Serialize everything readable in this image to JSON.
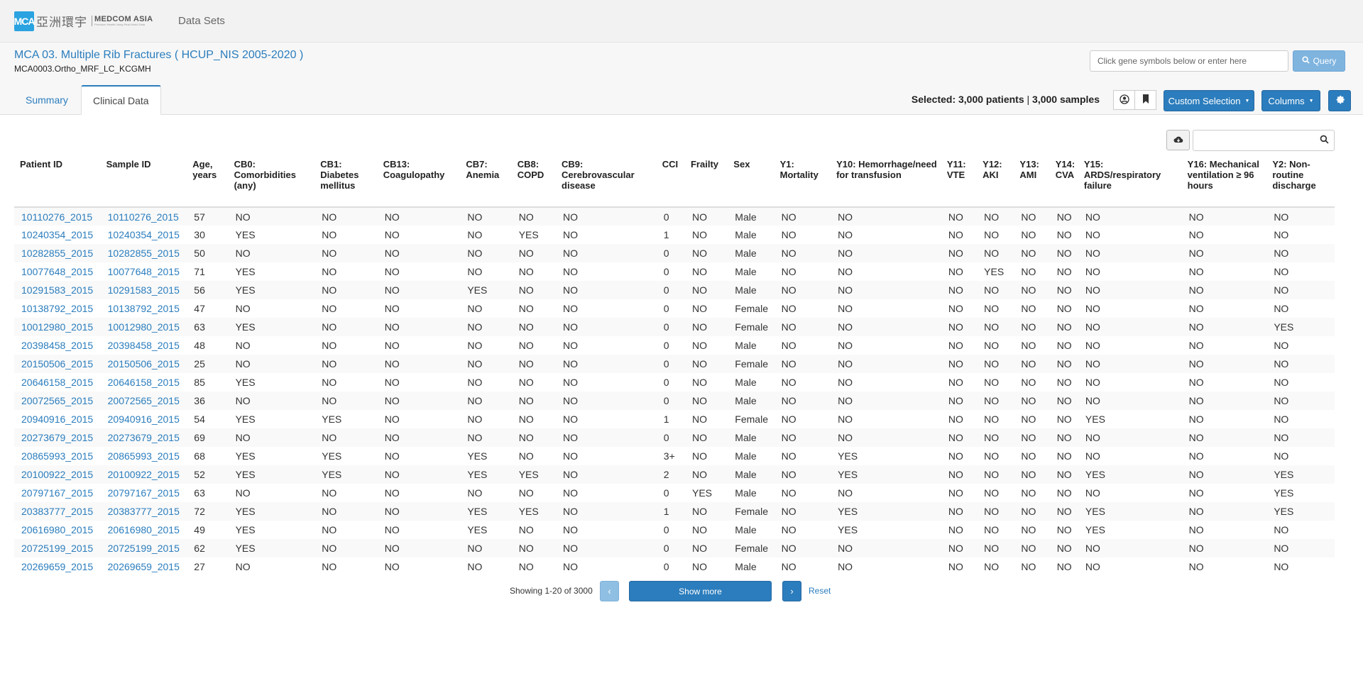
{
  "brand": {
    "mark": "MCA",
    "chinese": "亞洲環宇",
    "english": "MEDCOM ASIA",
    "tagline": "Precision Health Using Real-World Data"
  },
  "nav": {
    "data_sets": "Data Sets"
  },
  "study": {
    "title": "MCA 03. Multiple Rib Fractures ( HCUP_NIS 2005-2020 )",
    "id": "MCA0003.Ortho_MRF_LC_KCGMH"
  },
  "query": {
    "placeholder": "Click gene symbols below or enter here",
    "button": "Query"
  },
  "tabs": [
    {
      "label": "Summary",
      "active": false
    },
    {
      "label": "Clinical Data",
      "active": true
    }
  ],
  "selection": {
    "label": "Selected:",
    "patients": "3,000 patients",
    "sep": "|",
    "samples": "3,000 samples"
  },
  "buttons": {
    "custom_selection": "Custom Selection",
    "columns": "Columns"
  },
  "icons": {
    "user": "user-circle-icon",
    "bookmark": "bookmark-icon",
    "settings": "gear-icon",
    "download": "cloud-download-icon",
    "search": "search-icon"
  },
  "table": {
    "columns": [
      "Patient ID",
      "Sample ID",
      "Age, years",
      "CB0: Comorbidities (any)",
      "CB1: Diabetes mellitus",
      "CB13: Coagulopathy",
      "CB7: Anemia",
      "CB8: COPD",
      "CB9: Cerebrovascular disease",
      "CCI",
      "Frailty",
      "Sex",
      "Y1: Mortality",
      "Y10: Hemorrhage/need for transfusion",
      "Y11: VTE",
      "Y12: AKI",
      "Y13: AMI",
      "Y14: CVA",
      "Y15: ARDS/respiratory failure",
      "Y16: Mechanical ventilation ≥ 96 hours",
      "Y2: Non-routine discharge"
    ],
    "rows": [
      [
        "10110276_2015",
        "10110276_2015",
        "57",
        "NO",
        "NO",
        "NO",
        "NO",
        "NO",
        "NO",
        "0",
        "NO",
        "Male",
        "NO",
        "NO",
        "NO",
        "NO",
        "NO",
        "NO",
        "NO",
        "NO",
        "NO"
      ],
      [
        "10240354_2015",
        "10240354_2015",
        "30",
        "YES",
        "NO",
        "NO",
        "NO",
        "YES",
        "NO",
        "1",
        "NO",
        "Male",
        "NO",
        "NO",
        "NO",
        "NO",
        "NO",
        "NO",
        "NO",
        "NO",
        "NO"
      ],
      [
        "10282855_2015",
        "10282855_2015",
        "50",
        "NO",
        "NO",
        "NO",
        "NO",
        "NO",
        "NO",
        "0",
        "NO",
        "Male",
        "NO",
        "NO",
        "NO",
        "NO",
        "NO",
        "NO",
        "NO",
        "NO",
        "NO"
      ],
      [
        "10077648_2015",
        "10077648_2015",
        "71",
        "YES",
        "NO",
        "NO",
        "NO",
        "NO",
        "NO",
        "0",
        "NO",
        "Male",
        "NO",
        "NO",
        "NO",
        "YES",
        "NO",
        "NO",
        "NO",
        "NO",
        "NO"
      ],
      [
        "10291583_2015",
        "10291583_2015",
        "56",
        "YES",
        "NO",
        "NO",
        "YES",
        "NO",
        "NO",
        "0",
        "NO",
        "Male",
        "NO",
        "NO",
        "NO",
        "NO",
        "NO",
        "NO",
        "NO",
        "NO",
        "NO"
      ],
      [
        "10138792_2015",
        "10138792_2015",
        "47",
        "NO",
        "NO",
        "NO",
        "NO",
        "NO",
        "NO",
        "0",
        "NO",
        "Female",
        "NO",
        "NO",
        "NO",
        "NO",
        "NO",
        "NO",
        "NO",
        "NO",
        "NO"
      ],
      [
        "10012980_2015",
        "10012980_2015",
        "63",
        "YES",
        "NO",
        "NO",
        "NO",
        "NO",
        "NO",
        "0",
        "NO",
        "Female",
        "NO",
        "NO",
        "NO",
        "NO",
        "NO",
        "NO",
        "NO",
        "NO",
        "YES"
      ],
      [
        "20398458_2015",
        "20398458_2015",
        "48",
        "NO",
        "NO",
        "NO",
        "NO",
        "NO",
        "NO",
        "0",
        "NO",
        "Male",
        "NO",
        "NO",
        "NO",
        "NO",
        "NO",
        "NO",
        "NO",
        "NO",
        "NO"
      ],
      [
        "20150506_2015",
        "20150506_2015",
        "25",
        "NO",
        "NO",
        "NO",
        "NO",
        "NO",
        "NO",
        "0",
        "NO",
        "Female",
        "NO",
        "NO",
        "NO",
        "NO",
        "NO",
        "NO",
        "NO",
        "NO",
        "NO"
      ],
      [
        "20646158_2015",
        "20646158_2015",
        "85",
        "YES",
        "NO",
        "NO",
        "NO",
        "NO",
        "NO",
        "0",
        "NO",
        "Male",
        "NO",
        "NO",
        "NO",
        "NO",
        "NO",
        "NO",
        "NO",
        "NO",
        "NO"
      ],
      [
        "20072565_2015",
        "20072565_2015",
        "36",
        "NO",
        "NO",
        "NO",
        "NO",
        "NO",
        "NO",
        "0",
        "NO",
        "Male",
        "NO",
        "NO",
        "NO",
        "NO",
        "NO",
        "NO",
        "NO",
        "NO",
        "NO"
      ],
      [
        "20940916_2015",
        "20940916_2015",
        "54",
        "YES",
        "YES",
        "NO",
        "NO",
        "NO",
        "NO",
        "1",
        "NO",
        "Female",
        "NO",
        "NO",
        "NO",
        "NO",
        "NO",
        "NO",
        "YES",
        "NO",
        "NO"
      ],
      [
        "20273679_2015",
        "20273679_2015",
        "69",
        "NO",
        "NO",
        "NO",
        "NO",
        "NO",
        "NO",
        "0",
        "NO",
        "Male",
        "NO",
        "NO",
        "NO",
        "NO",
        "NO",
        "NO",
        "NO",
        "NO",
        "NO"
      ],
      [
        "20865993_2015",
        "20865993_2015",
        "68",
        "YES",
        "YES",
        "NO",
        "YES",
        "NO",
        "NO",
        "3+",
        "NO",
        "Male",
        "NO",
        "YES",
        "NO",
        "NO",
        "NO",
        "NO",
        "NO",
        "NO",
        "NO"
      ],
      [
        "20100922_2015",
        "20100922_2015",
        "52",
        "YES",
        "YES",
        "NO",
        "YES",
        "YES",
        "NO",
        "2",
        "NO",
        "Male",
        "NO",
        "YES",
        "NO",
        "NO",
        "NO",
        "NO",
        "YES",
        "NO",
        "YES"
      ],
      [
        "20797167_2015",
        "20797167_2015",
        "63",
        "NO",
        "NO",
        "NO",
        "NO",
        "NO",
        "NO",
        "0",
        "YES",
        "Male",
        "NO",
        "NO",
        "NO",
        "NO",
        "NO",
        "NO",
        "NO",
        "NO",
        "YES"
      ],
      [
        "20383777_2015",
        "20383777_2015",
        "72",
        "YES",
        "NO",
        "NO",
        "YES",
        "YES",
        "NO",
        "1",
        "NO",
        "Female",
        "NO",
        "YES",
        "NO",
        "NO",
        "NO",
        "NO",
        "YES",
        "NO",
        "YES"
      ],
      [
        "20616980_2015",
        "20616980_2015",
        "49",
        "YES",
        "NO",
        "NO",
        "YES",
        "NO",
        "NO",
        "0",
        "NO",
        "Male",
        "NO",
        "YES",
        "NO",
        "NO",
        "NO",
        "NO",
        "YES",
        "NO",
        "NO"
      ],
      [
        "20725199_2015",
        "20725199_2015",
        "62",
        "YES",
        "NO",
        "NO",
        "NO",
        "NO",
        "NO",
        "0",
        "NO",
        "Female",
        "NO",
        "NO",
        "NO",
        "NO",
        "NO",
        "NO",
        "NO",
        "NO",
        "NO"
      ],
      [
        "20269659_2015",
        "20269659_2015",
        "27",
        "NO",
        "NO",
        "NO",
        "NO",
        "NO",
        "NO",
        "0",
        "NO",
        "Male",
        "NO",
        "NO",
        "NO",
        "NO",
        "NO",
        "NO",
        "NO",
        "NO",
        "NO"
      ]
    ]
  },
  "pager": {
    "showing": "Showing 1-20 of 3000",
    "prev": "‹",
    "show_more": "Show more",
    "next": "›",
    "reset": "Reset"
  },
  "colors": {
    "accent": "#2b7dbd",
    "accent_light": "#8fbfe3",
    "brand": "#2aa3e0"
  }
}
